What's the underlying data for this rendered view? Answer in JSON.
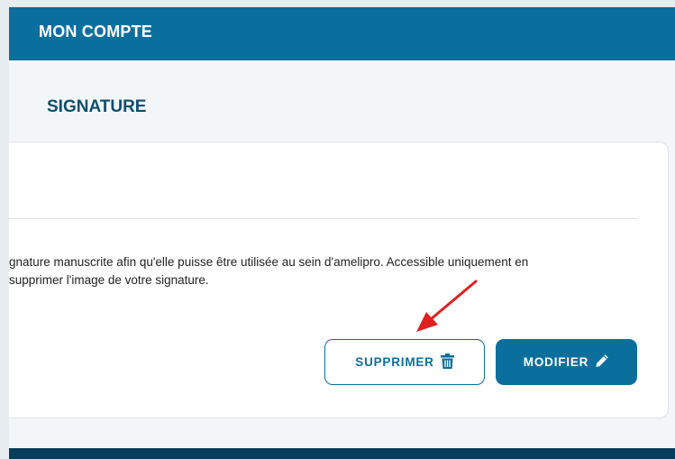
{
  "header": {
    "title": "MON COMPTE"
  },
  "section": {
    "title": "SIGNATURE"
  },
  "card": {
    "description_line1": "gnature manuscrite afin qu'elle puisse être utilisée au sein d'amelipro. Accessible uniquement en",
    "description_line2": "supprimer l'image de votre signature."
  },
  "buttons": {
    "delete_label": "SUPPRIMER",
    "delete_icon": "trash-icon",
    "modify_label": "MODIFIER",
    "modify_icon": "pencil-icon"
  },
  "colors": {
    "primary": "#0b6f9e",
    "dark": "#073c5a",
    "title": "#0d4f6e",
    "annotation_arrow": "#e02020"
  }
}
